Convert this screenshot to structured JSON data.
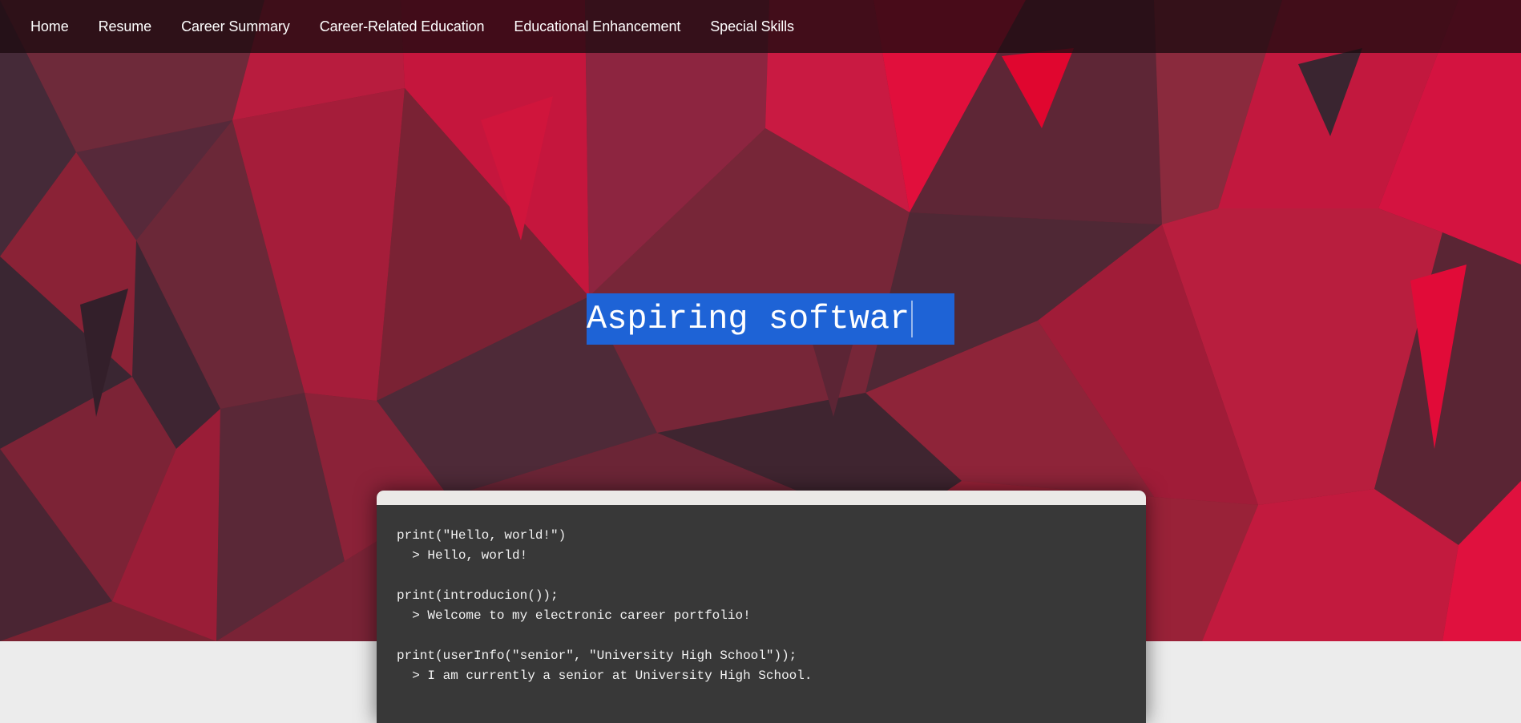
{
  "nav": {
    "items": [
      {
        "label": "Home"
      },
      {
        "label": "Resume"
      },
      {
        "label": "Career Summary"
      },
      {
        "label": "Career-Related Education"
      },
      {
        "label": "Educational Enhancement"
      },
      {
        "label": "Special Skills"
      }
    ]
  },
  "hero": {
    "headline": "Aspiring softwar",
    "selection_color": "#1e63d6"
  },
  "terminal": {
    "lines": [
      "print(\"Hello, world!\")",
      "  > Hello, world!",
      "",
      "print(introducion());",
      "  > Welcome to my electronic career portfolio!",
      "",
      "print(userInfo(\"senior\", \"University High School\"));",
      "  > I am currently a senior at University High School."
    ]
  },
  "colors": {
    "accent_red": "#e0062f",
    "dark_maroon": "#3a2632",
    "terminal_bg": "#383838"
  }
}
